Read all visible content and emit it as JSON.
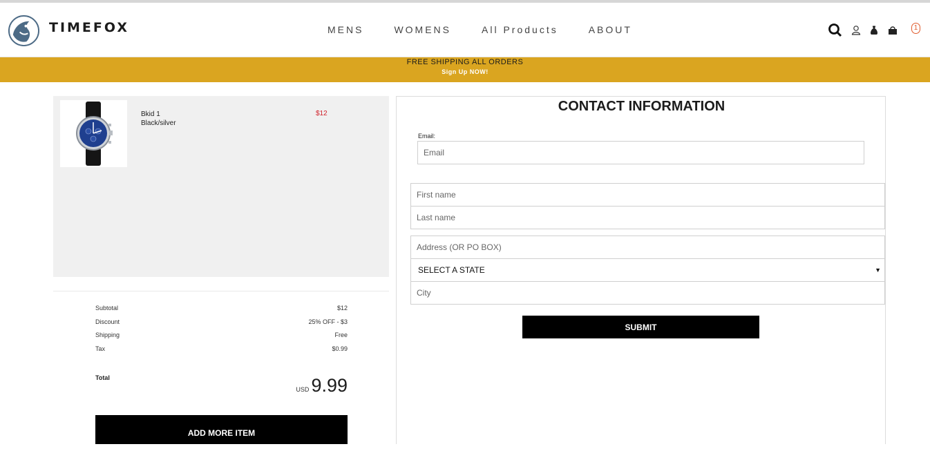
{
  "brand": {
    "name": "TIMEFOX"
  },
  "nav": {
    "items": [
      "MENS",
      "WOMENS",
      "All Products",
      "ABOUT"
    ]
  },
  "header_icons": {
    "search": "search-icon",
    "account": "user-icon",
    "wallet": "money-bag-icon",
    "cart": "shopping-bag-icon",
    "cart_count": "1"
  },
  "promo": {
    "line1": "FREE SHIPPING ALL ORDERS",
    "line2": "Sign Up NOW!"
  },
  "cart": {
    "item": {
      "name": "Bkid 1",
      "variant": "Black/silver",
      "price": "$12"
    },
    "summary": [
      {
        "label": "Subtotal",
        "value": "$12"
      },
      {
        "label": "Discount",
        "value": "25% OFF - $3"
      },
      {
        "label": "Shipping",
        "value": "Free"
      },
      {
        "label": "Tax",
        "value": "$0.99"
      }
    ],
    "total_label": "Total",
    "total_currency": "USD",
    "total_amount": "9.99",
    "add_more_label": "ADD MORE ITEM"
  },
  "contact": {
    "title": "CONTACT INFORMATION",
    "email_label": "Email:",
    "email_placeholder": "Email",
    "first_name_placeholder": "First name",
    "last_name_placeholder": "Last name",
    "address_placeholder": "Address (OR PO BOX)",
    "state_selected": "SELECT A STATE",
    "city_placeholder": "City",
    "submit_label": "SUBMIT"
  },
  "colors": {
    "promo_bg": "#daa520",
    "price_red": "#d0202a",
    "badge_orange": "#e05a2b"
  }
}
